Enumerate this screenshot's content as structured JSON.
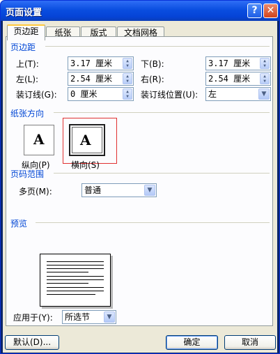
{
  "window": {
    "title": "页面设置",
    "help_glyph": "?",
    "close_glyph": "✕"
  },
  "tabs": [
    "页边距",
    "纸张",
    "版式",
    "文档网格"
  ],
  "margins": {
    "section": "页边距",
    "top_label": "上(T):",
    "top_value": "3.17 厘米",
    "bottom_label": "下(B):",
    "bottom_value": "3.17 厘米",
    "left_label": "左(L):",
    "left_value": "2.54 厘米",
    "right_label": "右(R):",
    "right_value": "2.54 厘米",
    "gutter_label": "装订线(G):",
    "gutter_value": "0 厘米",
    "gutter_pos_label": "装订线位置(U):",
    "gutter_pos_value": "左"
  },
  "orientation": {
    "section": "纸张方向",
    "portrait_label": "纵向(P)",
    "landscape_label": "横向(S)",
    "icon_letter": "A",
    "selected": "landscape"
  },
  "pages": {
    "section": "页码范围",
    "multi_label": "多页(M):",
    "multi_value": "普通"
  },
  "preview": {
    "section": "预览"
  },
  "apply": {
    "label": "应用于(Y):",
    "value": "所选节"
  },
  "buttons": {
    "default": "默认(D)...",
    "ok": "确定",
    "cancel": "取消"
  }
}
